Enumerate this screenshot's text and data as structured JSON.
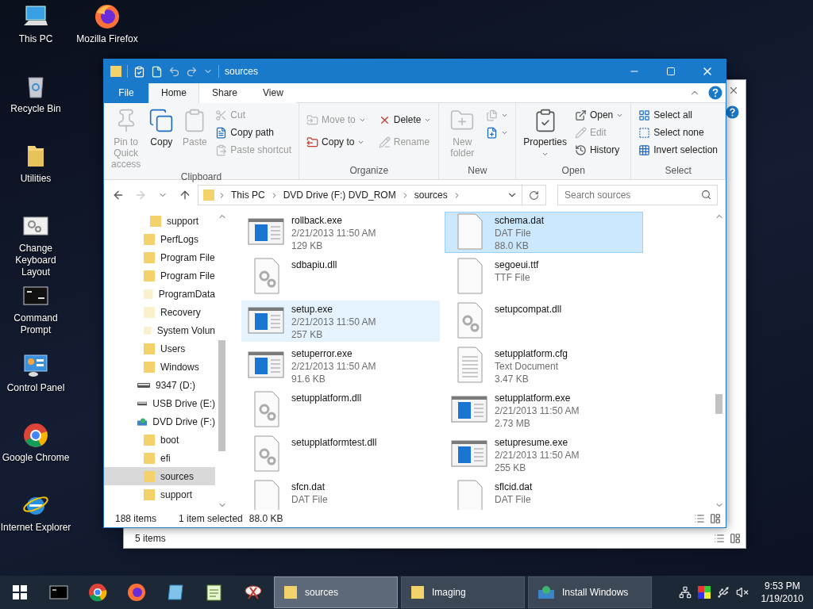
{
  "desktop_icons": [
    {
      "label": "This PC",
      "kind": "pc"
    },
    {
      "label": "Recycle Bin",
      "kind": "bin"
    },
    {
      "label": "Utilities",
      "kind": "folder"
    },
    {
      "label": "Change Keyboard Layout",
      "kind": "keyboard"
    },
    {
      "label": "Command Prompt",
      "kind": "cmd"
    },
    {
      "label": "Control Panel",
      "kind": "control"
    },
    {
      "label": "Google Chrome",
      "kind": "chrome"
    },
    {
      "label": "Internet Explorer",
      "kind": "ie"
    },
    {
      "label": "Mozilla Firefox",
      "kind": "firefox"
    }
  ],
  "back_window": {
    "status": "5 items"
  },
  "explorer": {
    "title": "sources",
    "ribbon_tabs": [
      {
        "label": "File",
        "kind": "file",
        "selected": false
      },
      {
        "label": "Home",
        "kind": "tab",
        "selected": true
      },
      {
        "label": "Share",
        "kind": "tab",
        "selected": false
      },
      {
        "label": "View",
        "kind": "tab",
        "selected": false
      }
    ],
    "ribbon_groups": [
      {
        "label": "Clipboard",
        "kind": "stack",
        "items": [
          {
            "label": "Pin to Quick access",
            "kind": "large",
            "disabled": true,
            "dropdown": false
          },
          {
            "label": "Copy",
            "kind": "large",
            "disabled": false,
            "dropdown": false
          },
          {
            "label": "Paste",
            "kind": "large",
            "disabled": true,
            "dropdown": false
          },
          {
            "label": "Cut",
            "kind": "small",
            "disabled": true,
            "dropdown": false
          },
          {
            "label": "Copy path",
            "kind": "small",
            "disabled": false,
            "dropdown": false
          },
          {
            "label": "Paste shortcut",
            "kind": "small",
            "disabled": true,
            "dropdown": false
          }
        ]
      },
      {
        "label": "Organize",
        "kind": "grid",
        "items": [
          {
            "label": "Move to",
            "kind": "small",
            "disabled": true,
            "dropdown": true
          },
          {
            "label": "Delete",
            "kind": "small",
            "disabled": false,
            "dropdown": true
          },
          {
            "label": "Copy to",
            "kind": "small",
            "disabled": false,
            "dropdown": true
          },
          {
            "label": "Rename",
            "kind": "small",
            "disabled": true,
            "dropdown": false
          }
        ]
      },
      {
        "label": "New",
        "kind": "stack",
        "items": [
          {
            "label": "New folder",
            "kind": "large",
            "disabled": true,
            "dropdown": false
          },
          {
            "kind": "small",
            "disabled": true,
            "dropdown": true
          },
          {
            "kind": "small",
            "disabled": false,
            "dropdown": true
          }
        ]
      },
      {
        "label": "Open",
        "kind": "stack",
        "items": [
          {
            "label": "Properties",
            "kind": "large",
            "disabled": false,
            "dropdown": true
          },
          {
            "label": "Open",
            "kind": "small",
            "disabled": false,
            "dropdown": true
          },
          {
            "label": "Edit",
            "kind": "small",
            "disabled": true,
            "dropdown": false
          },
          {
            "label": "History",
            "kind": "small",
            "disabled": false,
            "dropdown": false
          }
        ]
      },
      {
        "label": "Select",
        "kind": "stack",
        "items": [
          {
            "label": "Select all",
            "kind": "small",
            "disabled": false,
            "dropdown": false
          },
          {
            "label": "Select none",
            "kind": "small",
            "disabled": false,
            "dropdown": false
          },
          {
            "label": "Invert selection",
            "kind": "small",
            "disabled": false,
            "dropdown": false
          }
        ]
      }
    ],
    "address": {
      "path": [
        "This PC",
        "DVD Drive (F:) DVD_ROM",
        "sources"
      ]
    },
    "search": {
      "placeholder": "Search sources"
    },
    "nav_tree": [
      {
        "children": [
          {
            "children": [
              {
                "label": "support",
                "kind": "folder",
                "hidden": false,
                "selected": false
              }
            ]
          },
          {
            "label": "PerfLogs",
            "kind": "folder",
            "hidden": false,
            "selected": false
          },
          {
            "label": "Program File",
            "kind": "folder",
            "hidden": false,
            "selected": false
          },
          {
            "label": "Program File",
            "kind": "folder",
            "hidden": false,
            "selected": false
          },
          {
            "label": "ProgramData",
            "kind": "folder",
            "hidden": true,
            "selected": false
          },
          {
            "label": "Recovery",
            "kind": "folder",
            "hidden": true,
            "selected": false
          },
          {
            "label": "System Volun",
            "kind": "folder",
            "hidden": true,
            "selected": false
          },
          {
            "label": "Users",
            "kind": "folder",
            "hidden": false,
            "selected": false
          },
          {
            "label": "Windows",
            "kind": "folder",
            "hidden": false,
            "selected": false
          }
        ]
      },
      {
        "label": "9347 (D:)",
        "kind": "drive",
        "selected": false
      },
      {
        "label": "USB Drive (E:)",
        "kind": "drive",
        "selected": false
      },
      {
        "label": "DVD Drive (F:)",
        "kind": "dvd",
        "selected": false,
        "children": [
          {
            "label": "boot",
            "kind": "folder",
            "hidden": false,
            "selected": false
          },
          {
            "label": "efi",
            "kind": "folder",
            "hidden": false,
            "selected": false
          },
          {
            "label": "sources",
            "kind": "folder",
            "hidden": false,
            "selected": true
          },
          {
            "label": "support",
            "kind": "folder",
            "hidden": false,
            "selected": false
          }
        ]
      }
    ],
    "files": [
      {
        "name": "rollback.exe",
        "kind": "exe",
        "details": [
          "2/21/2013 11:50 AM",
          "129 KB"
        ],
        "selected": false,
        "hovered": false
      },
      {
        "name": "schema.dat",
        "kind": "blank",
        "details": [
          "DAT File",
          "88.0 KB"
        ],
        "selected": true,
        "hovered": false
      },
      {
        "name": "sdbapiu.dll",
        "kind": "dll",
        "selected": false,
        "hovered": false
      },
      {
        "name": "segoeui.ttf",
        "kind": "blank",
        "details": [
          "TTF File"
        ],
        "selected": false,
        "hovered": false
      },
      {
        "name": "setup.exe",
        "kind": "exe",
        "details": [
          "2/21/2013 11:50 AM",
          "257 KB"
        ],
        "selected": false,
        "hovered": true
      },
      {
        "name": "setupcompat.dll",
        "kind": "dll",
        "selected": false,
        "hovered": false
      },
      {
        "name": "setuperror.exe",
        "kind": "exe",
        "details": [
          "2/21/2013 11:50 AM",
          "91.6 KB"
        ],
        "selected": false,
        "hovered": false
      },
      {
        "name": "setupplatform.cfg",
        "kind": "text",
        "details": [
          "Text Document",
          "3.47 KB"
        ],
        "selected": false,
        "hovered": false
      },
      {
        "name": "setupplatform.dll",
        "kind": "dll",
        "selected": false,
        "hovered": false
      },
      {
        "name": "setupplatform.exe",
        "kind": "exe",
        "details": [
          "2/21/2013 11:50 AM",
          "2.73 MB"
        ],
        "selected": false,
        "hovered": false
      },
      {
        "name": "setupplatformtest.dll",
        "kind": "dll",
        "selected": false,
        "hovered": false
      },
      {
        "name": "setupresume.exe",
        "kind": "exe",
        "details": [
          "2/21/2013 11:50 AM",
          "255 KB"
        ],
        "selected": false,
        "hovered": false
      },
      {
        "name": "sfcn.dat",
        "kind": "blank",
        "details": [
          "DAT File"
        ],
        "selected": false,
        "hovered": false
      },
      {
        "name": "sflcid.dat",
        "kind": "blank",
        "details": [
          "DAT File"
        ],
        "selected": false,
        "hovered": false
      }
    ],
    "status": {
      "count": "188 items",
      "selection": "1 item selected",
      "size": "88.0 KB"
    }
  },
  "taskbar": {
    "pinned": [
      {
        "kind": "cmd"
      },
      {
        "kind": "chrome"
      },
      {
        "kind": "firefox"
      },
      {
        "kind": "app"
      },
      {
        "kind": "notepad"
      },
      {
        "kind": "snip"
      }
    ],
    "tasks": [
      {
        "label": "sources",
        "kind": "folder",
        "selected": true
      },
      {
        "label": "Imaging",
        "kind": "folder",
        "selected": false
      },
      {
        "label": "Install Windows",
        "kind": "setup",
        "selected": false
      }
    ],
    "time": "9:53 PM",
    "date": "1/19/2010"
  }
}
